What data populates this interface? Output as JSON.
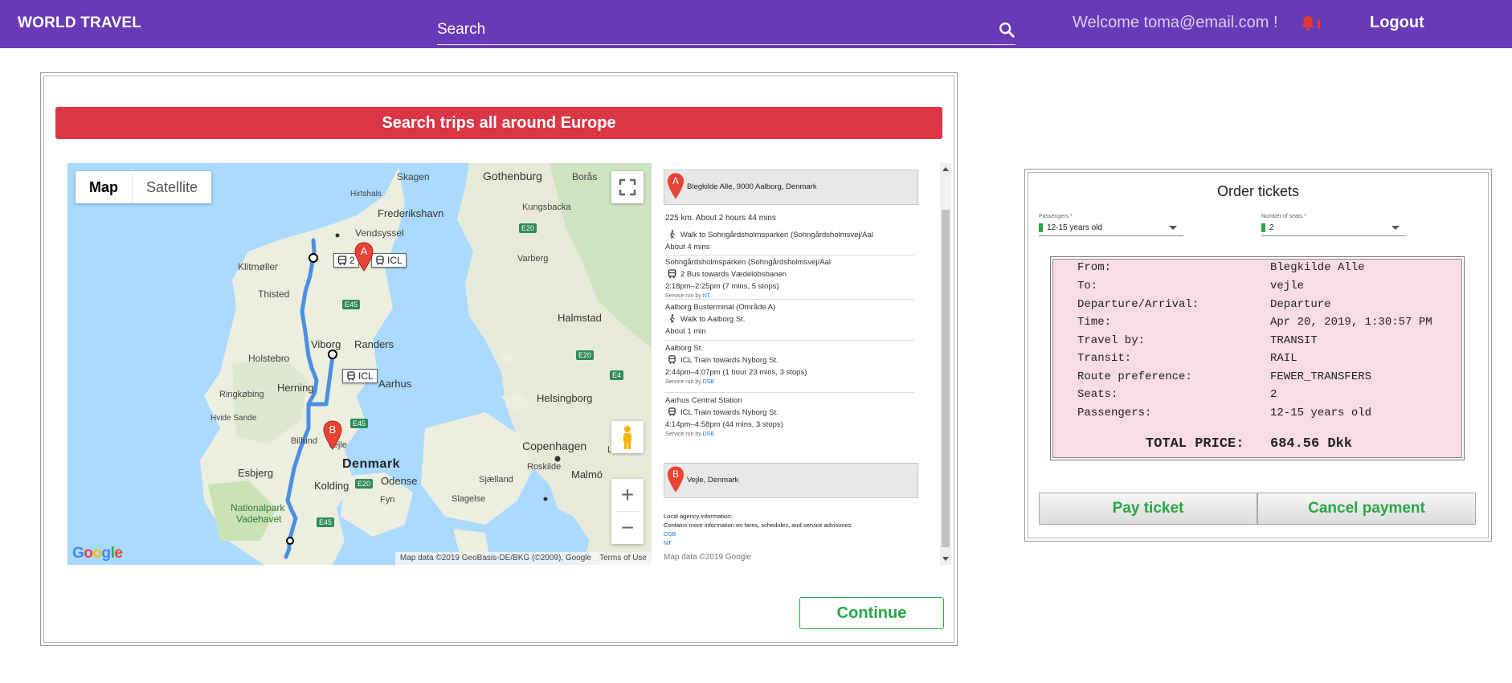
{
  "header": {
    "brand": "WORLD TRAVEL",
    "search_placeholder": "Search",
    "welcome": "Welcome toma@email.com !",
    "logout": "Logout"
  },
  "left_card": {
    "banner": "Search trips all around Europe",
    "map": {
      "type_options": [
        "Map",
        "Satellite"
      ],
      "selected_type": "Map",
      "logo": "Google",
      "attribution": "Map data ©2019 GeoBasis-DE/BKG (©2009), Google",
      "terms": "Terms of Use",
      "zoom_in": "+",
      "zoom_out": "−",
      "labels": {
        "skagen": "Skagen",
        "gothenburg": "Gothenburg",
        "boras": "Borås",
        "hirtshals": "Hirtshals",
        "frederikshavn": "Frederikshavn",
        "kungsbacka": "Kungsbacka",
        "vendsyssel": "Vendsyssel",
        "klitmoller": "Klitmøller",
        "varberg": "Varberg",
        "thisted": "Thisted",
        "halmstad": "Halmstad",
        "viborg": "Viborg",
        "randers": "Randers",
        "holstebro": "Holstebro",
        "herning": "Herning",
        "aarhus": "Aarhus",
        "ringkobing": "Ringkøbing",
        "helsingborg": "Helsingborg",
        "hvide_sande": "Hvide Sande",
        "billund": "Billund",
        "vejle": "Vejle",
        "copenhagen": "Copenhagen",
        "denmark": "Denmark",
        "esbjerg": "Esbjerg",
        "odense": "Odense",
        "roskilde": "Roskilde",
        "malmo": "Malmö",
        "kolding": "Kolding",
        "fyn": "Fyn",
        "sjaelland": "Sjælland",
        "slagelse": "Slagelse",
        "lund": "Lund",
        "nationalpark": "Nationalpark",
        "vadehavet": "Vadehavet"
      },
      "highways": {
        "e20a": "E20",
        "e45a": "E45",
        "e20b": "E20",
        "e4": "E4",
        "e45b": "E45",
        "e20c": "E20",
        "e45c": "E45"
      },
      "chips": {
        "bus": "2",
        "icl_a": "ICL",
        "icl_b": "ICL"
      },
      "markers": {
        "a": "A",
        "b": "B"
      }
    },
    "directions": {
      "origin": "Blegkilde Alle, 9000 Aalborg, Denmark",
      "summary": "225 km. About 2 hours 44 mins",
      "steps": [
        {
          "title": "",
          "instruction": "Walk to Sohngårdsholmsparken (Sohngårdsholmsvej/Aal",
          "detail": "About 4 mins",
          "service": ""
        },
        {
          "title": "Sohngårdsholmsparken (Sohngårdsholmsvej/Aal",
          "instruction": "2 Bus towards Vædelobsbanen",
          "detail": "2:18pm–2:25pm (7 mins, 5 stops)",
          "service_label": "Service run by",
          "service": "NT"
        },
        {
          "title": "Aalborg Busterminal (Område A)",
          "instruction": "Walk to Aalborg St.",
          "detail": "About 1 min",
          "service": ""
        },
        {
          "title": "Aalborg St.",
          "instruction": "ICL Train towards Nyborg St.",
          "detail": "2:44pm–4:07pm (1 hour 23 mins, 3 stops)",
          "service_label": "Service run by",
          "service": "DSB"
        },
        {
          "title": "Aarhus Central Station",
          "instruction": "ICL Train towards Nyborg St.",
          "detail": "4:14pm–4:58pm (44 mins, 3 stops)",
          "service_label": "Service run by",
          "service": "DSB"
        }
      ],
      "destination": "Vejle, Denmark",
      "agency_title": "Local agency information:",
      "agency_desc": "Contains more information on fares, schedules, and service advisories.",
      "agency_links": [
        "DSB",
        "NT"
      ],
      "map_credit": "Map data ©2019 Google"
    },
    "continue": "Continue"
  },
  "order": {
    "title": "Order tickets",
    "passengers_label": "Passengers *",
    "passengers_value": "12-15 years old",
    "seats_label": "Number of seats *",
    "seats_value": "2",
    "rows": [
      {
        "key": "From:",
        "value": "Blegkilde Alle"
      },
      {
        "key": "To:",
        "value": "vejle"
      },
      {
        "key": "Departure/Arrival:",
        "value": "Departure"
      },
      {
        "key": "Time:",
        "value": "Apr 20, 2019, 1:30:57 PM"
      },
      {
        "key": "Travel by:",
        "value": "TRANSIT"
      },
      {
        "key": "Transit:",
        "value": "RAIL"
      },
      {
        "key": "Route preference:",
        "value": "FEWER_TRANSFERS"
      },
      {
        "key": "Seats:",
        "value": "2"
      },
      {
        "key": "Passengers:",
        "value": "12-15 years old"
      }
    ],
    "total_label": "TOTAL PRICE:",
    "total_value": "684.56 Dkk",
    "pay": "Pay ticket",
    "cancel": "Cancel payment"
  },
  "colors": {
    "header_bg": "#673ab7",
    "banner_bg": "#dc3545",
    "action_green": "#28a745",
    "summary_bg": "#fadce4"
  }
}
